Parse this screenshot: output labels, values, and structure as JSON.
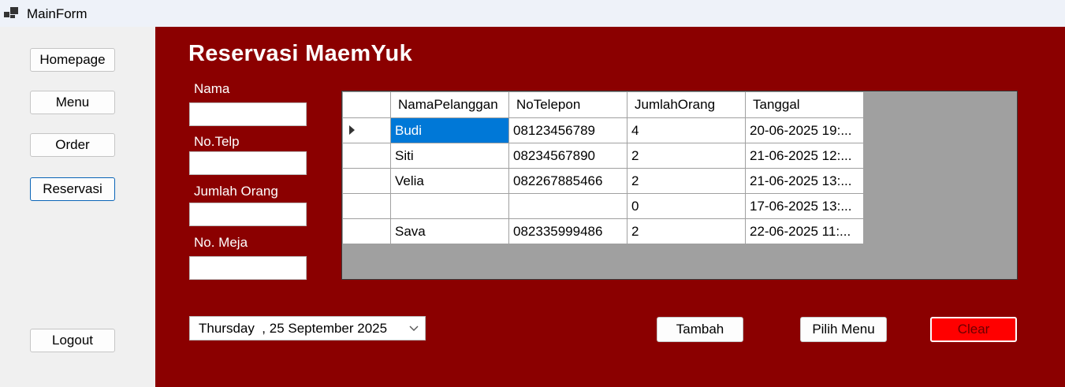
{
  "window": {
    "title": "MainForm"
  },
  "sidebar": {
    "items": [
      {
        "label": "Homepage"
      },
      {
        "label": "Menu"
      },
      {
        "label": "Order"
      },
      {
        "label": "Reservasi"
      }
    ],
    "logout_label": "Logout"
  },
  "main": {
    "title": "Reservasi MaemYuk",
    "fields": {
      "nama": {
        "label": "Nama",
        "value": ""
      },
      "telp": {
        "label": "No.Telp",
        "value": ""
      },
      "jumlah": {
        "label": "Jumlah Orang",
        "value": ""
      },
      "meja": {
        "label": "No. Meja",
        "value": ""
      }
    },
    "grid": {
      "columns": [
        "NamaPelanggan",
        "NoTelepon",
        "JumlahOrang",
        "Tanggal"
      ],
      "rows": [
        [
          "Budi",
          "08123456789",
          "4",
          "20-06-2025 19:..."
        ],
        [
          "Siti",
          "08234567890",
          "2",
          "21-06-2025 12:..."
        ],
        [
          "Velia",
          "082267885466",
          "2",
          "21-06-2025 13:..."
        ],
        [
          "",
          "",
          "0",
          "17-06-2025 13:..."
        ],
        [
          "Sava",
          "082335999486",
          "2",
          "22-06-2025 11:..."
        ]
      ]
    },
    "date_picker": {
      "value": "Thursday  , 25 September 2025"
    },
    "buttons": {
      "tambah": "Tambah",
      "pilih_menu": "Pilih Menu",
      "clear": "Clear"
    }
  },
  "colors": {
    "main_background": "#8b0000",
    "selection": "#0078d7",
    "clear_button": "#ff0000"
  }
}
